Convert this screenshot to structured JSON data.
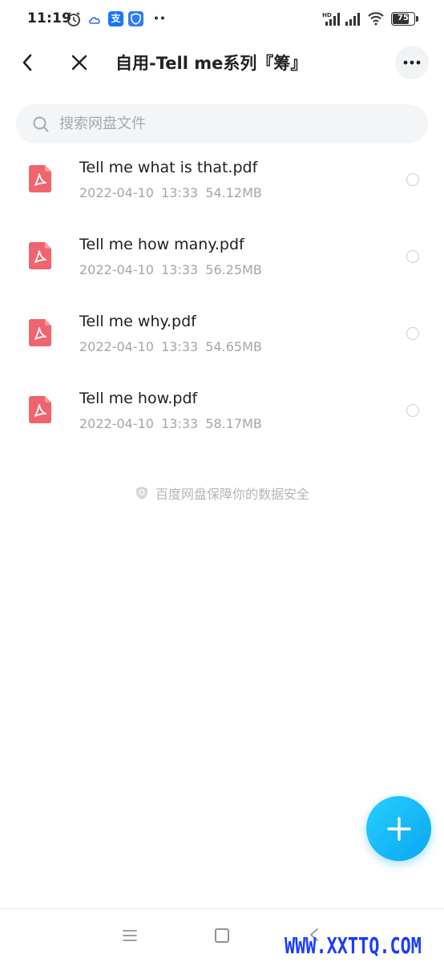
{
  "status_bar": {
    "time": "11:19",
    "battery": 75,
    "battery_label": "75",
    "network_label": "HD"
  },
  "header": {
    "title": "自用-Tell me系列『筹』"
  },
  "search": {
    "placeholder": "搜索网盘文件",
    "value": ""
  },
  "files": [
    {
      "name": "Tell me what is that.pdf",
      "date": "2022-04-10",
      "time": "13:33",
      "size": "54.12MB"
    },
    {
      "name": "Tell me how many.pdf",
      "date": "2022-04-10",
      "time": "13:33",
      "size": "56.25MB"
    },
    {
      "name": "Tell me why.pdf",
      "date": "2022-04-10",
      "time": "13:33",
      "size": "54.65MB"
    },
    {
      "name": "Tell me how.pdf",
      "date": "2022-04-10",
      "time": "13:33",
      "size": "58.17MB"
    }
  ],
  "footer": {
    "safety_text": "百度网盘保障你的数据安全"
  },
  "watermark": "WWW.XXTTQ.COM",
  "colors": {
    "accent": "#0aa6f0",
    "pdf_red": "#f0646e",
    "muted_text": "#a3a6ad"
  },
  "icons": {
    "file_type": "pdf-icon",
    "fab": "plus-icon",
    "back": "chevron-left-icon",
    "close": "close-icon",
    "more": "more-dots-icon"
  }
}
